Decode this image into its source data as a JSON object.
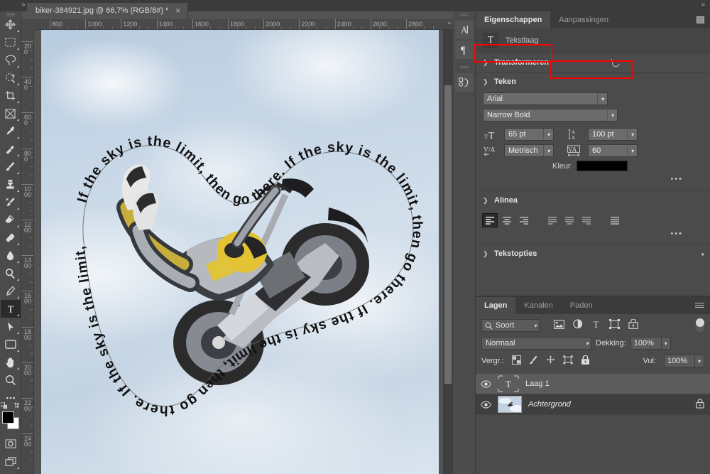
{
  "window": {
    "collapse_left_icon": "chevron-double-right-icon",
    "collapse_right_icon": "chevron-double-right-icon"
  },
  "document_tab": {
    "title": "biker-384921.jpg @ 66,7% (RGB/8#) *",
    "close_label": "×"
  },
  "toolbar": {
    "tools": [
      {
        "name": "move-tool",
        "label": "Verplaatsen",
        "selected": false
      },
      {
        "name": "rectangular-marquee-tool",
        "label": "Rechthoekig selectiekader",
        "selected": false
      },
      {
        "name": "lasso-tool",
        "label": "Lasso",
        "selected": false
      },
      {
        "name": "quick-selection-tool",
        "label": "Snelle selectie",
        "selected": false
      },
      {
        "name": "crop-tool",
        "label": "Uitsnijden",
        "selected": false
      },
      {
        "name": "frame-tool",
        "label": "Kader",
        "selected": false
      },
      {
        "name": "eyedropper-tool",
        "label": "Pipet",
        "selected": false
      },
      {
        "name": "spot-healing-brush-tool",
        "label": "Retoucheerpenseel",
        "selected": false
      },
      {
        "name": "brush-tool",
        "label": "Penseel",
        "selected": false
      },
      {
        "name": "clone-stamp-tool",
        "label": "Kloonstempel",
        "selected": false
      },
      {
        "name": "history-brush-tool",
        "label": "Historiepenseel",
        "selected": false
      },
      {
        "name": "eraser-tool",
        "label": "Gum",
        "selected": false
      },
      {
        "name": "gradient-tool",
        "label": "Verloop",
        "selected": false
      },
      {
        "name": "blur-tool",
        "label": "Vervagen",
        "selected": false
      },
      {
        "name": "dodge-tool",
        "label": "Tegenhouden",
        "selected": false
      },
      {
        "name": "pen-tool",
        "label": "Pen",
        "selected": false
      },
      {
        "name": "type-tool",
        "label": "Tekst",
        "selected": true
      },
      {
        "name": "path-selection-tool",
        "label": "Padselectie",
        "selected": false
      },
      {
        "name": "rectangle-tool",
        "label": "Rechthoek",
        "selected": false
      },
      {
        "name": "hand-tool",
        "label": "Handje",
        "selected": false
      },
      {
        "name": "zoom-tool",
        "label": "Zoomen",
        "selected": false
      },
      {
        "name": "edit-toolbar-tool",
        "label": "Werkbalk bewerken",
        "selected": false
      }
    ],
    "foreground_color": "#000000",
    "background_color": "#ffffff"
  },
  "rulers": {
    "horizontal_ticks": [
      "800",
      "1000",
      "1200",
      "1400",
      "1600",
      "1800",
      "2000",
      "2200",
      "2400",
      "2600",
      "2800"
    ],
    "vertical_ticks": [
      "200",
      "400",
      "600",
      "800",
      "1000",
      "1200",
      "1400",
      "1600",
      "1800",
      "2000",
      "2200",
      "2400"
    ],
    "collapse_icon": "chevron-up-icon"
  },
  "canvas": {
    "artwork_text": "If the sky is the limit, then go there.",
    "zoom_level": "66,7%",
    "color_mode": "RGB/8#"
  },
  "dock": {
    "buttons": [
      {
        "name": "character-panel-icon",
        "glyph": "A"
      },
      {
        "name": "paragraph-panel-icon",
        "glyph": "¶"
      },
      {
        "name": "glyphs-panel-icon",
        "glyph": "⚗"
      }
    ]
  },
  "properties": {
    "tabs": [
      {
        "label": "Eigenschappen",
        "active": true
      },
      {
        "label": "Aanpassingen",
        "active": false
      }
    ],
    "header": {
      "icon": "T",
      "title": "Tekstlaag"
    },
    "sections": {
      "transform": {
        "title": "Transformeren",
        "expanded": false,
        "reset_icon": "reset-icon"
      },
      "character": {
        "title": "Teken",
        "expanded": true,
        "font_family": "Arial",
        "font_style": "Narrow Bold",
        "font_size": "65 pt",
        "leading": "100 pt",
        "kerning": "Metrisch",
        "tracking": "60",
        "color_label": "Kleur",
        "color_value": "#000000",
        "more_label": "•••",
        "highlight_color": "#ff0000"
      },
      "paragraph": {
        "title": "Alinea",
        "expanded": true,
        "alignments": [
          {
            "name": "align-left-button",
            "selected": true
          },
          {
            "name": "align-center-button",
            "selected": false
          },
          {
            "name": "align-right-button",
            "selected": false
          },
          {
            "name": "justify-last-left-button",
            "selected": false
          },
          {
            "name": "justify-last-center-button",
            "selected": false
          },
          {
            "name": "justify-last-right-button",
            "selected": false
          },
          {
            "name": "justify-all-button",
            "selected": false
          }
        ],
        "more_label": "•••"
      },
      "text_options": {
        "title": "Tekstopties",
        "expanded": true
      }
    }
  },
  "layers_panel": {
    "tabs": [
      {
        "label": "Lagen",
        "active": true
      },
      {
        "label": "Kanalen",
        "active": false
      },
      {
        "label": "Paden",
        "active": false
      }
    ],
    "filter": {
      "kind_label": "Soort",
      "icons": [
        "filter-pixel-icon",
        "filter-adjustment-icon",
        "filter-type-icon",
        "filter-shape-icon",
        "filter-smartobject-icon"
      ],
      "toggle_name": "filter-enable-toggle"
    },
    "blend_mode": "Normaal",
    "opacity_label": "Dekking:",
    "opacity_value": "100%",
    "lock_label": "Vergr.:",
    "fill_label": "Vul:",
    "fill_value": "100%",
    "lock_icons": [
      "lock-transparent-pixels-icon",
      "lock-image-pixels-icon",
      "lock-position-icon",
      "lock-nesting-icon",
      "lock-all-icon"
    ],
    "layers": [
      {
        "name": "Laag 1",
        "type": "text",
        "visible": true,
        "selected": true,
        "locked": false,
        "italic": false
      },
      {
        "name": "Achtergrond",
        "type": "image",
        "visible": true,
        "selected": false,
        "locked": true,
        "italic": true
      }
    ]
  }
}
